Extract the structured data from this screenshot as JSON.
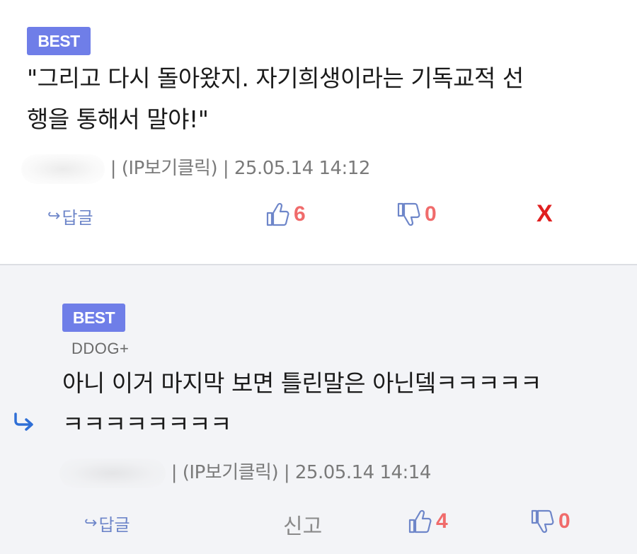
{
  "comments": [
    {
      "badge": "BEST",
      "text_line1": "\"그리고 다시 돌아왔지. 자기희생이라는 기독교적 선",
      "text_line2": "행을 통해서 말야!\"",
      "ip_label": "| (IP보기클릭) | 25.05.14 14:12",
      "reply_label": "답글",
      "upvotes": "6",
      "downvotes": "0",
      "delete_label": "X",
      "colors": {
        "badge": "#6f7ee8",
        "count": "#f06b6b",
        "icon": "#6e86c9",
        "delete": "#e02020"
      }
    },
    {
      "badge": "BEST",
      "nickname": "DDOG+",
      "text_line1": "아니 이거 마지막 보면 틀린말은 아닌뎈ㅋㅋㅋㅋㅋ",
      "text_line2": "ㅋㅋㅋㅋㅋㅋㅋㅋ",
      "ip_label": "| (IP보기클릭) | 25.05.14 14:14",
      "reply_label": "답글",
      "report_label": "신고",
      "upvotes": "4",
      "downvotes": "0",
      "icons": [
        "reply-arrow-icon",
        "thumbs-up-icon",
        "thumbs-down-icon"
      ]
    }
  ]
}
